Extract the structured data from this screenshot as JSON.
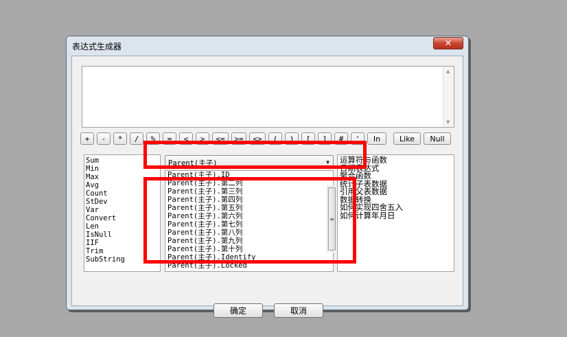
{
  "window": {
    "title": "表达式生成器",
    "close_label": "✕"
  },
  "expression": {
    "value": ""
  },
  "operators": [
    "+",
    "-",
    "*",
    "/",
    "%",
    "=",
    "<",
    ">",
    "<=",
    ">=",
    "<>",
    "(",
    ")",
    "[",
    "]",
    "#",
    "'",
    "In",
    "Like",
    "Null"
  ],
  "functions": [
    "Sum",
    "Min",
    "Max",
    "Avg",
    "Count",
    "StDev",
    "Var",
    "Convert",
    "Len",
    "IsNull",
    "IIF",
    "Trim",
    "SubString"
  ],
  "field_selector": {
    "selected": "Parent(主子)"
  },
  "fields": [
    "Parent(主子).ID",
    "Parent(主子).第二列",
    "Parent(主子).第三列",
    "Parent(主子).第四列",
    "Parent(主子).第五列",
    "Parent(主子).第六列",
    "Parent(主子).第七列",
    "Parent(主子).第八列",
    "Parent(主子).第九列",
    "Parent(主子).第十列",
    "Parent(主子).Identify",
    "Parent(主子).Locked"
  ],
  "help_topics": [
    "运算符与函数",
    "日期表达式",
    "聚合函数",
    "统计子表数据",
    "引用父表数据",
    "数据转换",
    "如何实现四舍五入",
    "如何计算年月日"
  ],
  "buttons": {
    "ok": "确定",
    "cancel": "取消"
  },
  "highlight_color": "#ff0000"
}
